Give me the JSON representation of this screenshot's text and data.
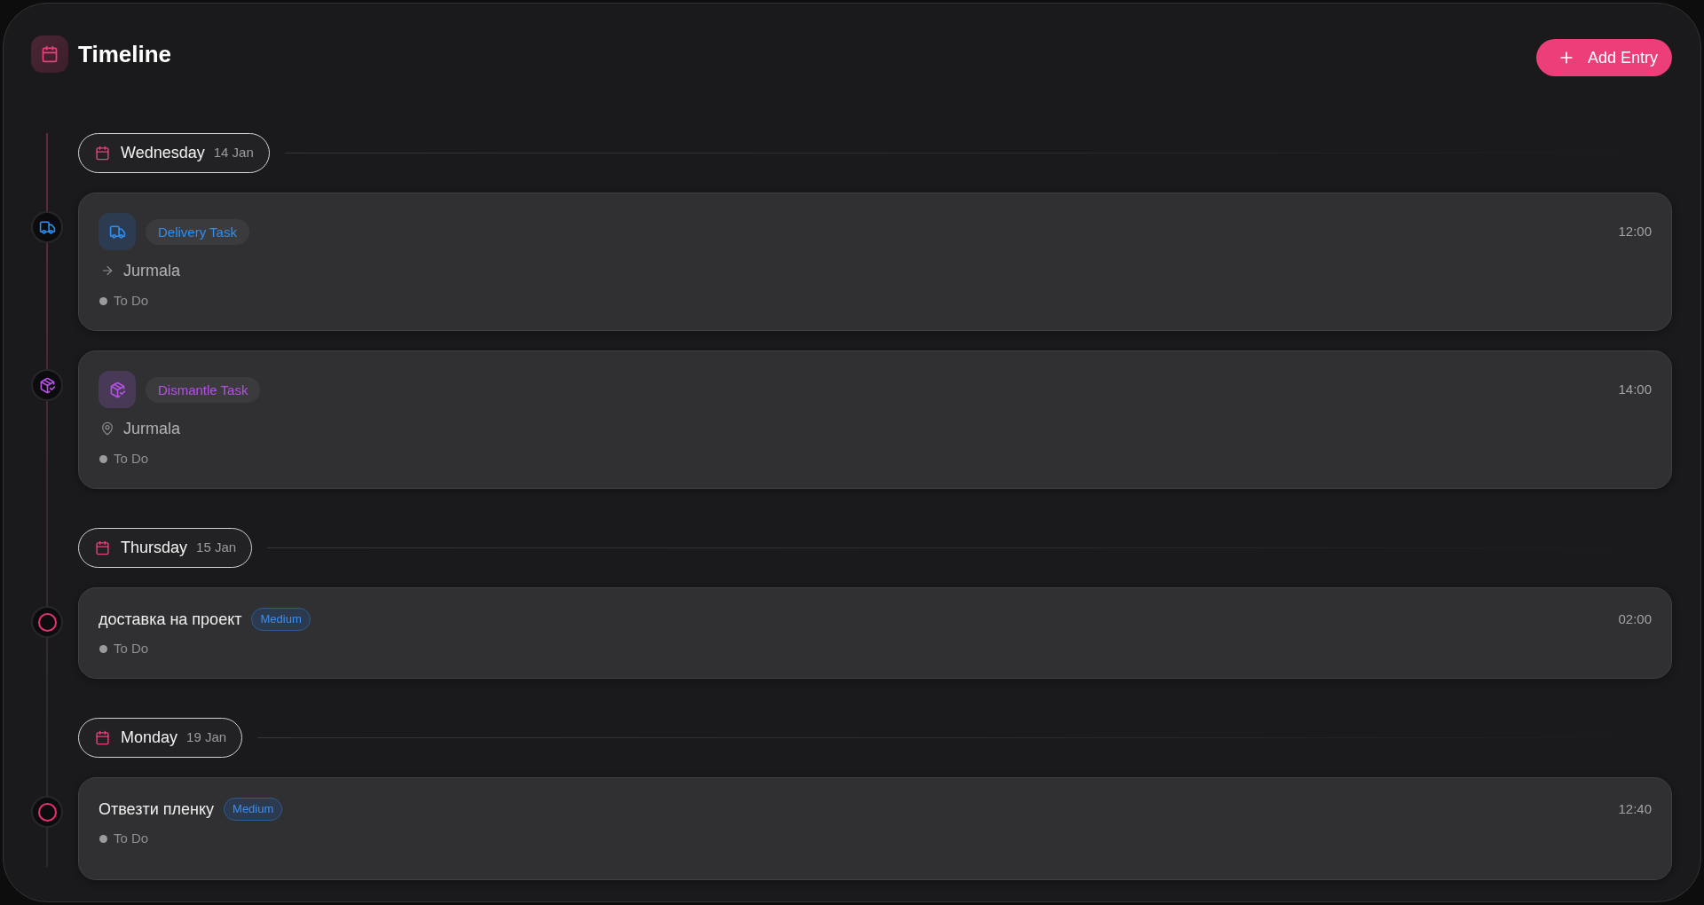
{
  "header": {
    "title": "Timeline",
    "add_button": "Add Entry"
  },
  "days": [
    {
      "weekday": "Wednesday",
      "date": "14 Jan",
      "entries": [
        {
          "kind": "delivery",
          "type_label": "Delivery Task",
          "location": "Jurmala",
          "status": "To Do",
          "time": "12:00"
        },
        {
          "kind": "dismantle",
          "type_label": "Dismantle Task",
          "location": "Jurmala",
          "status": "To Do",
          "time": "14:00"
        }
      ]
    },
    {
      "weekday": "Thursday",
      "date": "15 Jan",
      "entries": [
        {
          "kind": "task",
          "title": "доставка на проект",
          "priority": "Medium",
          "status": "To Do",
          "time": "02:00"
        }
      ]
    },
    {
      "weekday": "Monday",
      "date": "19 Jan",
      "entries": [
        {
          "kind": "task",
          "title": "Отвезти пленку",
          "priority": "Medium",
          "status": "To Do",
          "time": "12:40"
        }
      ]
    }
  ]
}
